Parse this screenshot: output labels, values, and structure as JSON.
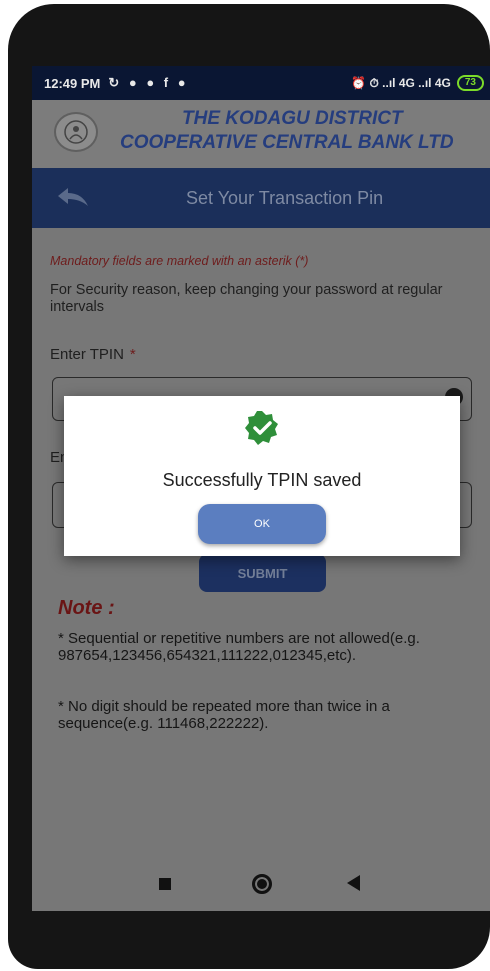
{
  "status_bar": {
    "time": "12:49 PM",
    "left_icons": "↻ ● ● f ●",
    "right_text": "⏰ ⏱ ..ıl 4G ..ıl 4G",
    "battery": "73"
  },
  "header": {
    "bank_name_line1": "THE KODAGU DISTRICT",
    "bank_name_line2": "COOPERATIVE CENTRAL BANK LTD"
  },
  "title_bar": {
    "title": "Set Your Transaction Pin"
  },
  "form": {
    "mandatory_note": "Mandatory fields are marked with an asterik (*)",
    "security_note": "For Security reason, keep changing your password at regular intervals",
    "tpin_label": "Enter TPIN",
    "asterisk": "*",
    "confirm_label_partial": "En",
    "submit_label": "SUBMIT"
  },
  "notes": {
    "title": "Note :",
    "note1": "* Sequential or repetitive numbers are not allowed(e.g. 987654,123456,654321,111222,012345,etc).",
    "note2": "* No digit should be repeated more than twice in a sequence(e.g. 111468,222222)."
  },
  "dialog": {
    "message": "Successfully TPIN saved",
    "ok_label": "OK",
    "icon": "check-badge-icon",
    "icon_color": "#2f8f3a"
  },
  "colors": {
    "header_blue": "#1b2f5a",
    "status_bar": "#0a1633",
    "button_blue": "#5b7ec0"
  }
}
